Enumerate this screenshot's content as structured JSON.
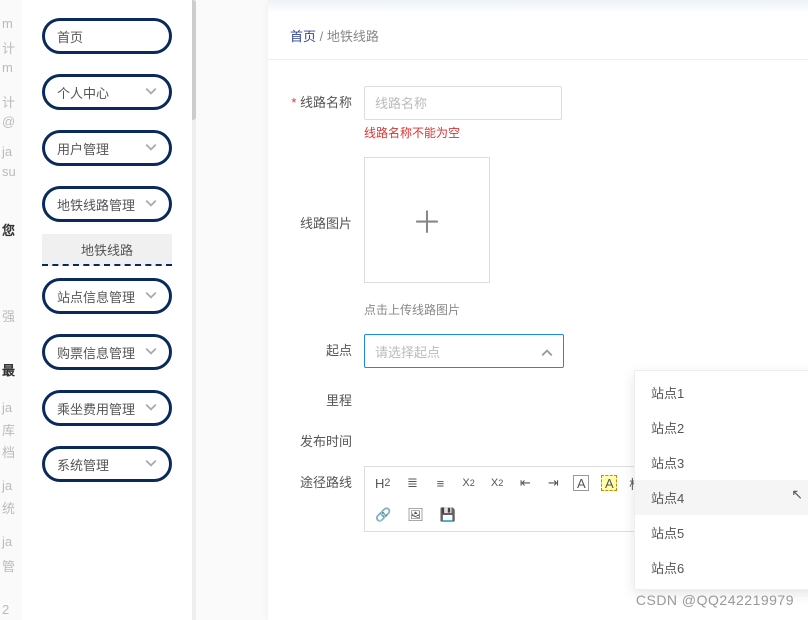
{
  "bg_fragments": [
    "m",
    "计",
    "m",
    "计",
    "@",
    "ja",
    "su",
    "您",
    "强",
    "最",
    "ja",
    "库",
    "档",
    "ja",
    "统",
    "ja",
    "管",
    "2"
  ],
  "sidebar": {
    "items": [
      {
        "label": "首页",
        "expandable": false
      },
      {
        "label": "个人中心",
        "expandable": true
      },
      {
        "label": "用户管理",
        "expandable": true
      },
      {
        "label": "地铁线路管理",
        "expandable": true,
        "sub": "地铁线路"
      },
      {
        "label": "站点信息管理",
        "expandable": true
      },
      {
        "label": "购票信息管理",
        "expandable": true
      },
      {
        "label": "乘坐费用管理",
        "expandable": true
      },
      {
        "label": "系统管理",
        "expandable": true
      }
    ]
  },
  "breadcrumb": {
    "home": "首页",
    "sep": "/",
    "current": "地铁线路"
  },
  "form": {
    "name": {
      "label": "线路名称",
      "placeholder": "线路名称",
      "error": "线路名称不能为空"
    },
    "image": {
      "label": "线路图片",
      "hint": "点击上传线路图片"
    },
    "start": {
      "label": "起点",
      "placeholder": "请选择起点",
      "options": [
        "站点1",
        "站点2",
        "站点3",
        "站点4",
        "站点5",
        "站点6"
      ],
      "hover_index": 3
    },
    "mileage": {
      "label": "里程"
    },
    "publish": {
      "label": "发布时间"
    },
    "route": {
      "label": "途径路线"
    }
  },
  "editor": {
    "font_label": "标准字体"
  },
  "watermark": "CSDN @QQ242219979"
}
